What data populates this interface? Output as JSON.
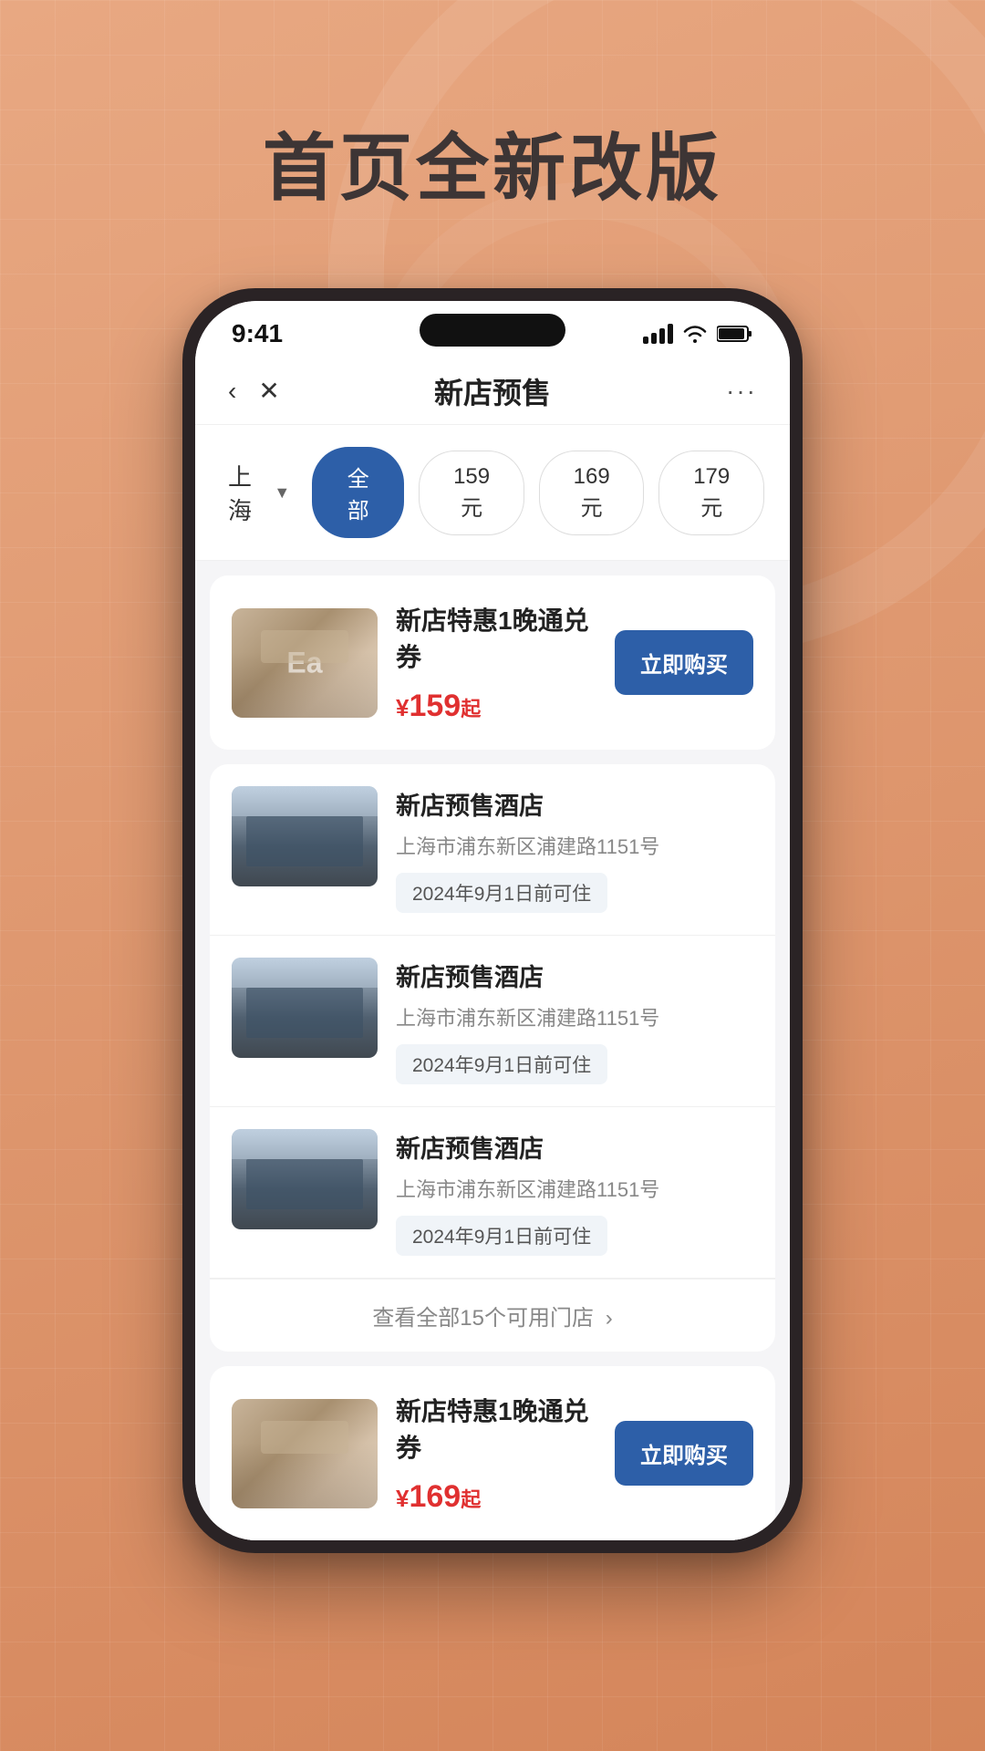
{
  "background": {
    "title": "首页全新改版"
  },
  "statusBar": {
    "time": "9:41",
    "signal": "signal",
    "wifi": "wifi",
    "battery": "battery"
  },
  "header": {
    "title": "新店预售",
    "backLabel": "‹",
    "closeLabel": "✕",
    "moreLabel": "···"
  },
  "filterBar": {
    "city": "上海",
    "cityArrow": "▼",
    "filters": [
      {
        "label": "全部",
        "active": true
      },
      {
        "label": "159元",
        "active": false
      },
      {
        "label": "169元",
        "active": false
      },
      {
        "label": "179元",
        "active": false
      }
    ]
  },
  "cards": [
    {
      "type": "voucher",
      "title": "新店特惠1晚通兑券",
      "pricePrefix": "¥",
      "priceNum": "159",
      "priceSuffix": "起",
      "buyLabel": "立即购买",
      "imageType": "lobby"
    },
    {
      "type": "hotel-list",
      "hotels": [
        {
          "name": "新店预售酒店",
          "address": "上海市浦东新区浦建路1151号",
          "tag": "2024年9月1日前可住",
          "imageType": "exterior"
        },
        {
          "name": "新店预售酒店",
          "address": "上海市浦东新区浦建路1151号",
          "tag": "2024年9月1日前可住",
          "imageType": "exterior"
        },
        {
          "name": "新店预售酒店",
          "address": "上海市浦东新区浦建路1151号",
          "tag": "2024年9月1日前可住",
          "imageType": "exterior"
        }
      ],
      "viewAllText": "查看全部15个可用门店",
      "viewAllArrow": "›"
    },
    {
      "type": "voucher",
      "title": "新店特惠1晚通兑券",
      "pricePrefix": "¥",
      "priceNum": "169",
      "priceSuffix": "起",
      "buyLabel": "立即购买",
      "imageType": "lobby"
    }
  ]
}
